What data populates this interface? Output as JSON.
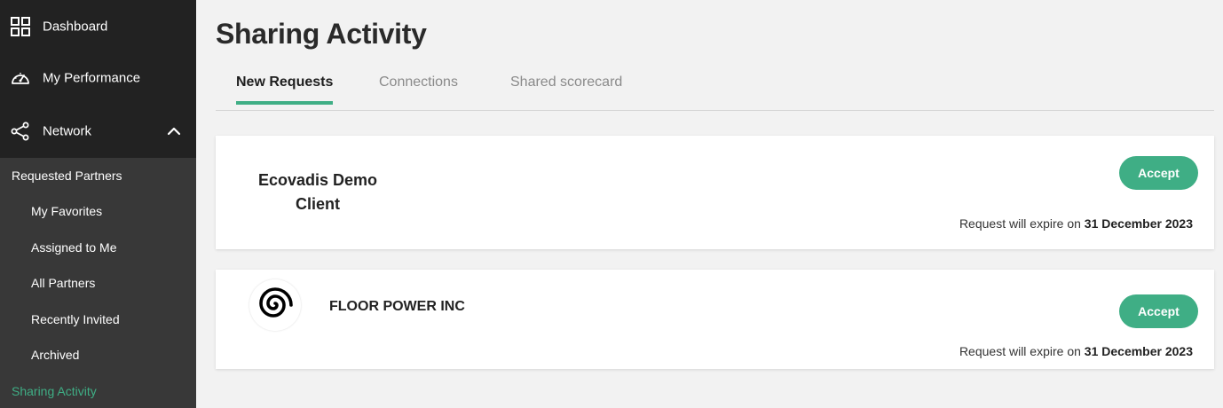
{
  "sidebar": {
    "top_items": [
      {
        "label": "Dashboard",
        "icon": "grid-icon"
      },
      {
        "label": "My Performance",
        "icon": "speedometer-icon"
      },
      {
        "label": "Network",
        "icon": "share-network-icon",
        "expanded": true
      }
    ],
    "sub_items": [
      {
        "label": "Requested Partners",
        "active": false
      },
      {
        "label": "My Favorites",
        "active": false
      },
      {
        "label": "Assigned to Me",
        "active": false
      },
      {
        "label": "All Partners",
        "active": false
      },
      {
        "label": "Recently Invited",
        "active": false
      },
      {
        "label": "Archived",
        "active": false
      },
      {
        "label": "Sharing Activity",
        "active": true
      }
    ]
  },
  "main": {
    "title": "Sharing Activity",
    "tabs": [
      {
        "label": "New Requests",
        "active": true
      },
      {
        "label": "Connections",
        "active": false
      },
      {
        "label": "Shared scorecard",
        "active": false
      }
    ],
    "requests": [
      {
        "company": "Ecovadis Demo Client",
        "company_line1": "Ecovadis Demo",
        "company_line2": "Client",
        "accept_label": "Accept",
        "expire_prefix": "Request will expire on",
        "expire_date": "31 December 2023"
      },
      {
        "company": "FLOOR POWER INC",
        "logo": "spiral-logo",
        "accept_label": "Accept",
        "expire_prefix": "Request will expire on",
        "expire_date": "31 December 2023"
      }
    ]
  },
  "colors": {
    "accent": "#3fae85",
    "sidebar_bg": "#222222",
    "subnav_bg": "#383838",
    "page_bg": "#f2f2f2"
  }
}
